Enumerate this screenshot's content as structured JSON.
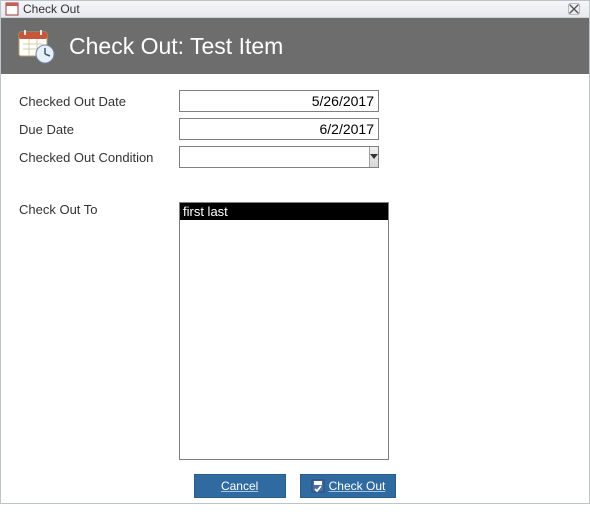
{
  "window": {
    "title": "Check Out"
  },
  "header": {
    "title": "Check Out: Test Item"
  },
  "form": {
    "checked_out_date": {
      "label": "Checked Out Date",
      "value": "5/26/2017"
    },
    "due_date": {
      "label": "Due Date",
      "value": "6/2/2017"
    },
    "condition": {
      "label": "Checked Out Condition",
      "value": ""
    },
    "check_out_to": {
      "label": "Check Out To"
    }
  },
  "listbox": {
    "selected_index": 0,
    "items": [
      "first last"
    ]
  },
  "buttons": {
    "cancel": "Cancel",
    "check_out": "Check Out"
  }
}
